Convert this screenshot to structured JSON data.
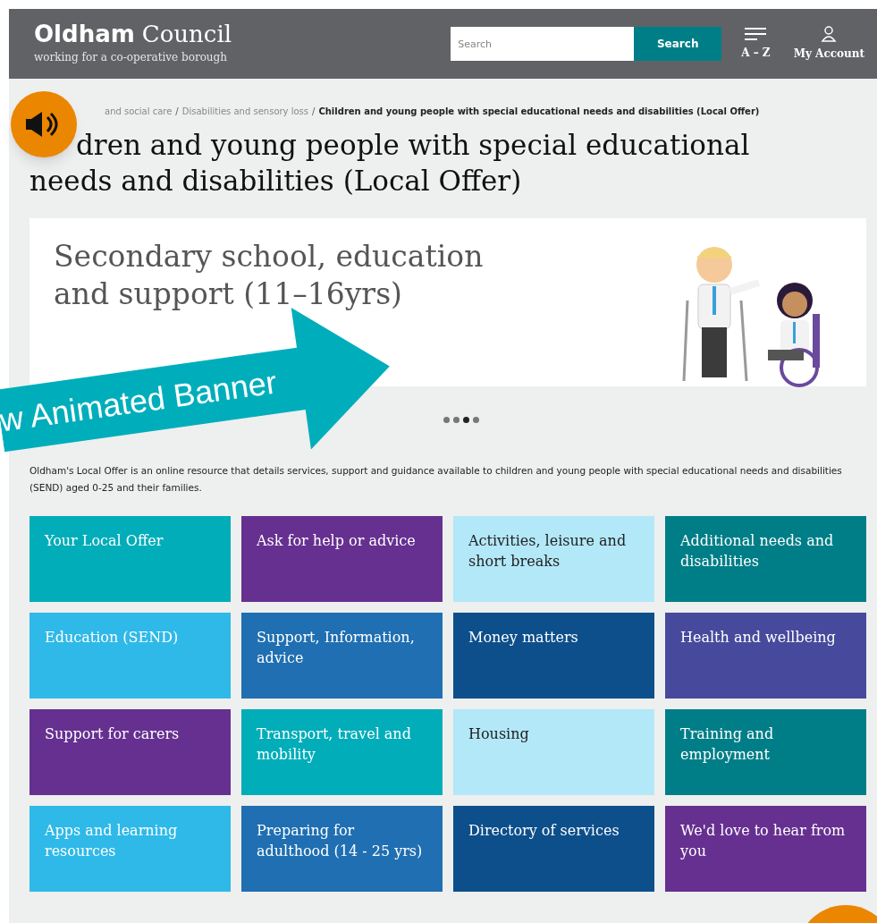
{
  "header": {
    "logo_title_bold": "Oldham",
    "logo_title": "Council",
    "logo_tagline": "working for a co-operative borough",
    "search": {
      "placeholder": "Search",
      "button": "Search"
    },
    "nav": [
      {
        "kind": "menu",
        "label": "A – Z"
      },
      {
        "kind": "account",
        "label": "My Account"
      }
    ]
  },
  "breadcrumb": [
    {
      "label": "and social care",
      "current": false
    },
    {
      "separator": "/",
      "label": "Disabilities and sensory loss",
      "current": false
    },
    {
      "separator": "/",
      "label": "Children and young people with special educational needs and disabilities (Local Offer)",
      "current": true
    }
  ],
  "heading_lines": [
    "dren and young people with special educational",
    "needs and disabilities (Local Offer)"
  ],
  "banner": {
    "title": "Secondary school, education and support (11–16yrs)",
    "slides": [
      {
        "selected": false
      },
      {
        "selected": false
      },
      {
        "selected": true
      },
      {
        "selected": false
      }
    ]
  },
  "annotation": {
    "label": "w Animated Banner"
  },
  "intro": "Oldham's Local Offer is an online resource that details services, support and guidance available to children and young people with special educational needs and disabilities (SEND) aged 0-25 and their families.",
  "tiles": [
    {
      "label": "Your Local Offer",
      "color": "#00adb9"
    },
    {
      "label": "Ask for help or advice",
      "color": "#663090"
    },
    {
      "label": "Activities, leisure and short breaks",
      "color": "#b3e8f8"
    },
    {
      "label": "Additional needs and disabilities",
      "color": "#007e87"
    },
    {
      "label": "Education (SEND)",
      "color": "#2fb9e8"
    },
    {
      "label": "Support, Information, advice",
      "color": "#1f6fb2"
    },
    {
      "label": "Money matters",
      "color": "#0d4f8b"
    },
    {
      "label": "Health and wellbeing",
      "color": "#474a9c"
    },
    {
      "label": "Support for carers",
      "color": "#663090"
    },
    {
      "label": "Transport, travel and mobility",
      "color": "#00adb9"
    },
    {
      "label": "Housing",
      "color": "#b3e8f8"
    },
    {
      "label": "Training and employment",
      "color": "#007e87"
    },
    {
      "label": "Apps and learning resources",
      "color": "#2fb9e8"
    },
    {
      "label": "Preparing for adulthood (14 - 25 yrs)",
      "color": "#1f6fb2"
    },
    {
      "label": "Directory of services",
      "color": "#0d4f8b"
    },
    {
      "label": "We'd love to hear from you",
      "color": "#663090"
    }
  ]
}
